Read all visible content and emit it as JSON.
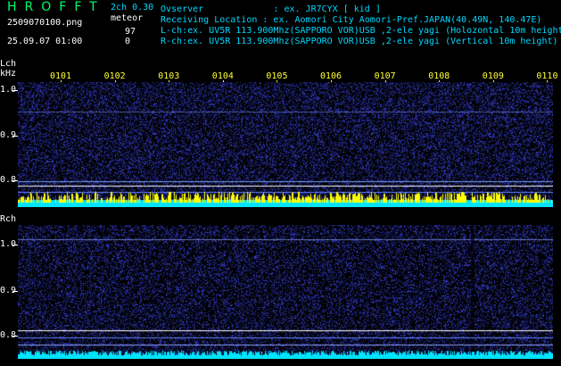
{
  "app": {
    "logo": "HROFFT",
    "mode": "2ch 0.30",
    "type_label": "meteor",
    "filename": "2509070100.png",
    "datetime": "25.09.07 01:00",
    "count_l": "97",
    "count_r": "0"
  },
  "header": {
    "observer": "Ovserver             : ex. JR7CYX [ kid ]",
    "location": "Receiving Location : ex. Aomori City Aomori-Pref.JAPAN(40.49N, 140.47E)",
    "lch": "L-ch:ex. UV5R 113.900Mhz(SAPPORO VOR)USB ,2-ele yagi (Holozontal 10m height)",
    "rch": "R-ch:ex. UV5R 113.900Mhz(SAPPORO VOR)USB ,2-ele yagi (Vertical 10m height)"
  },
  "lch_panel": {
    "label": "Lch",
    "unit": "kHz",
    "y_ticks": [
      "1.0",
      "0.9",
      "0.8"
    ],
    "time_ticks": [
      "0101",
      "0102",
      "0103",
      "0104",
      "0105",
      "0106",
      "0107",
      "0108",
      "0109",
      "0110"
    ]
  },
  "rch_panel": {
    "label": "Rch",
    "y_ticks": [
      "1.0",
      "0.9",
      "0.8"
    ]
  },
  "colors": {
    "background": "#000000",
    "noise": "#1a2a9a",
    "signal_cyan": "#00e5ff",
    "signal_yellow": "#ffff00",
    "tick_yellow": "#ffff33",
    "header_cyan": "#00d8ff",
    "logo_green": "#00ff66"
  }
}
